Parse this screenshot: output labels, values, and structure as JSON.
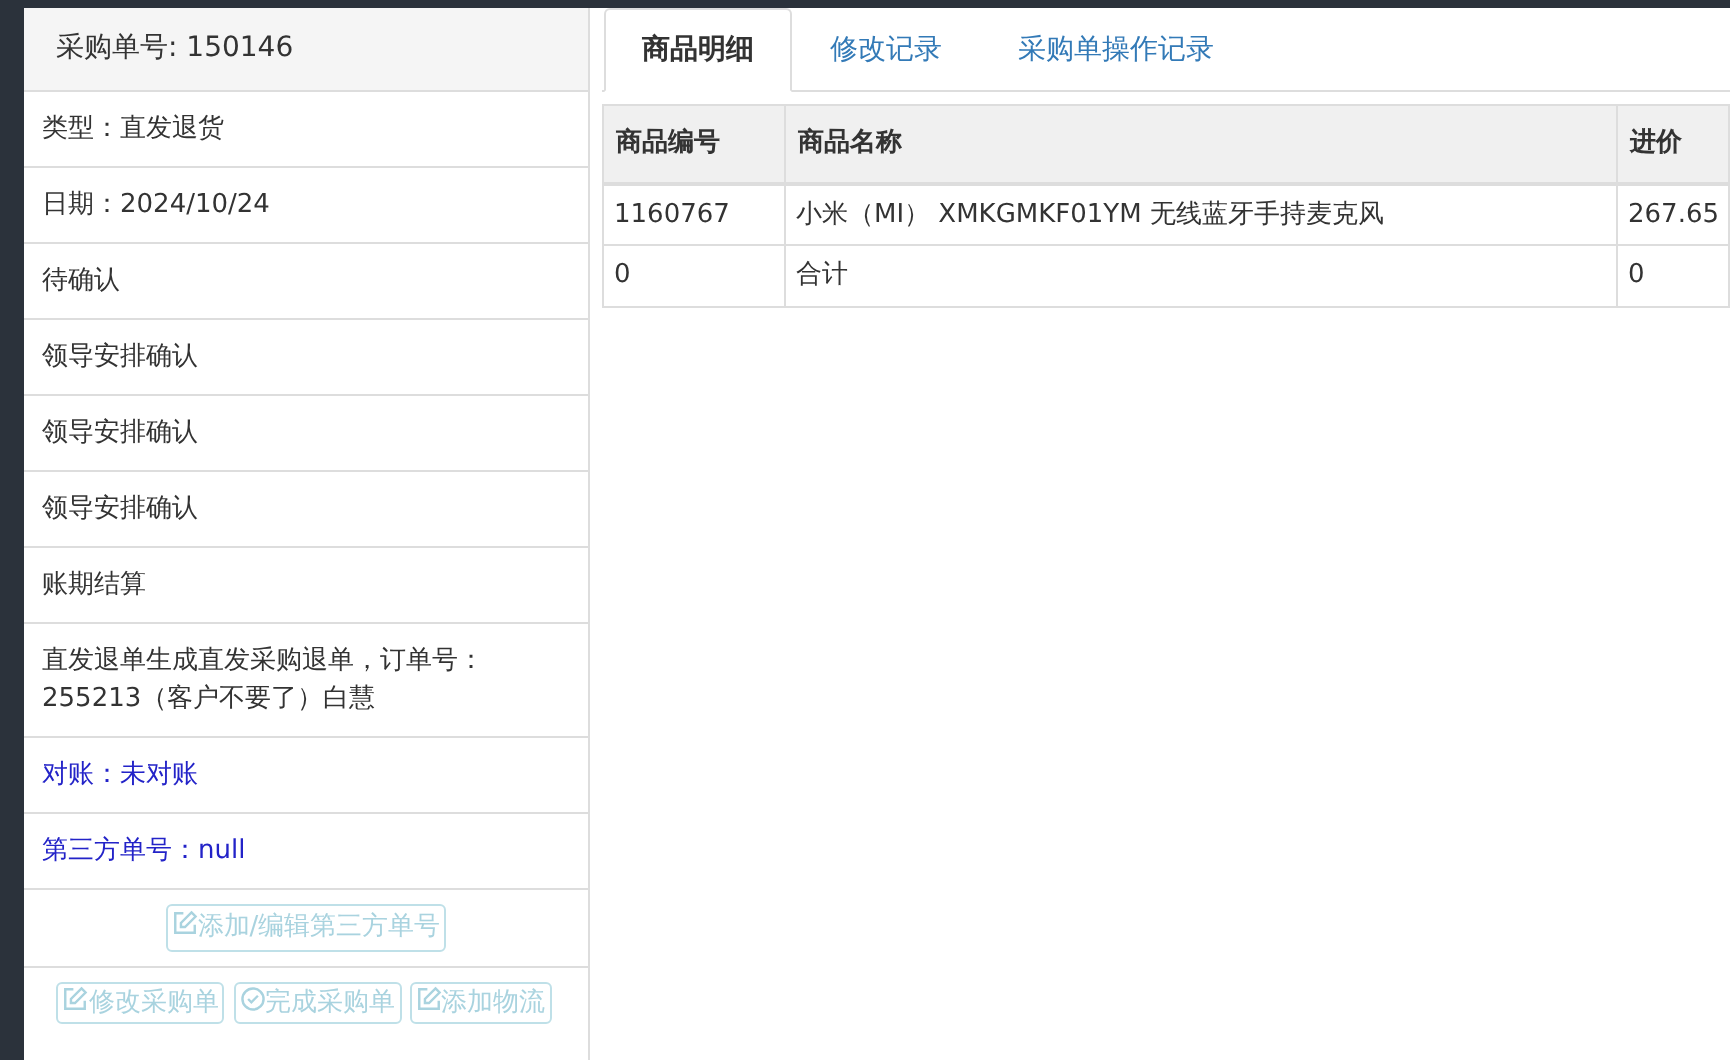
{
  "order_header": {
    "label": "采购单号:",
    "value": "150146"
  },
  "info_rows": [
    {
      "text": "类型：直发退货",
      "kind": "plain"
    },
    {
      "text": "日期：2024/10/24",
      "kind": "plain"
    },
    {
      "text": "待确认",
      "kind": "plain"
    },
    {
      "text": "领导安排确认",
      "kind": "plain"
    },
    {
      "text": "领导安排确认",
      "kind": "plain"
    },
    {
      "text": "领导安排确认",
      "kind": "plain"
    },
    {
      "text": "账期结算",
      "kind": "plain"
    },
    {
      "text": "直发退单生成直发采购退单，订单号：255213（客户不要了）白慧",
      "kind": "plain"
    },
    {
      "text": "对账：未对账",
      "kind": "highlight"
    },
    {
      "text": "第三方单号：null",
      "kind": "highlight"
    }
  ],
  "third_party_button": {
    "label": "添加/编辑第三方单号",
    "kind": "edit",
    "disabled": true
  },
  "action_buttons": [
    {
      "label": "修改采购单",
      "kind": "edit",
      "disabled": true
    },
    {
      "label": "完成采购单",
      "kind": "check",
      "disabled": true
    },
    {
      "label": "添加物流",
      "kind": "edit",
      "disabled": true
    }
  ],
  "tabs": [
    {
      "label": "商品明细",
      "selected": true
    },
    {
      "label": "修改记录",
      "selected": false
    },
    {
      "label": "采购单操作记录",
      "selected": false
    }
  ],
  "table": {
    "columns": [
      "商品编号",
      "商品名称",
      "进价"
    ],
    "rows": [
      [
        "1160767",
        "小米（MI） XMKGMKF01YM 无线蓝牙手持麦克风",
        "267.65"
      ],
      [
        "0",
        "合计",
        "0"
      ]
    ]
  }
}
